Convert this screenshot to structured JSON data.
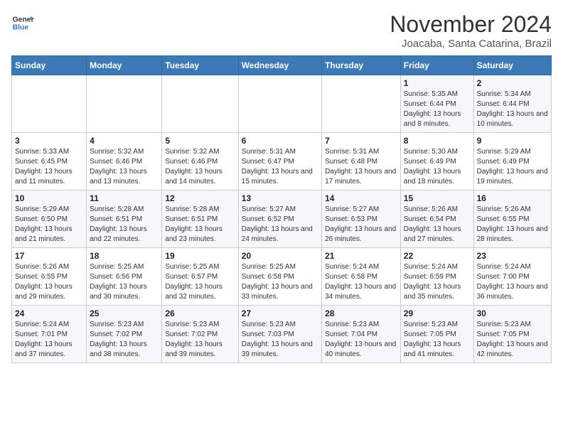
{
  "header": {
    "logo_text_top": "General",
    "logo_text_bottom": "Blue",
    "title": "November 2024",
    "subtitle": "Joacaba, Santa Catarina, Brazil"
  },
  "weekdays": [
    "Sunday",
    "Monday",
    "Tuesday",
    "Wednesday",
    "Thursday",
    "Friday",
    "Saturday"
  ],
  "weeks": [
    [
      {
        "day": "",
        "info": ""
      },
      {
        "day": "",
        "info": ""
      },
      {
        "day": "",
        "info": ""
      },
      {
        "day": "",
        "info": ""
      },
      {
        "day": "",
        "info": ""
      },
      {
        "day": "1",
        "info": "Sunrise: 5:35 AM\nSunset: 6:44 PM\nDaylight: 13 hours and 8 minutes."
      },
      {
        "day": "2",
        "info": "Sunrise: 5:34 AM\nSunset: 6:44 PM\nDaylight: 13 hours and 10 minutes."
      }
    ],
    [
      {
        "day": "3",
        "info": "Sunrise: 5:33 AM\nSunset: 6:45 PM\nDaylight: 13 hours and 11 minutes."
      },
      {
        "day": "4",
        "info": "Sunrise: 5:32 AM\nSunset: 6:46 PM\nDaylight: 13 hours and 13 minutes."
      },
      {
        "day": "5",
        "info": "Sunrise: 5:32 AM\nSunset: 6:46 PM\nDaylight: 13 hours and 14 minutes."
      },
      {
        "day": "6",
        "info": "Sunrise: 5:31 AM\nSunset: 6:47 PM\nDaylight: 13 hours and 15 minutes."
      },
      {
        "day": "7",
        "info": "Sunrise: 5:31 AM\nSunset: 6:48 PM\nDaylight: 13 hours and 17 minutes."
      },
      {
        "day": "8",
        "info": "Sunrise: 5:30 AM\nSunset: 6:49 PM\nDaylight: 13 hours and 18 minutes."
      },
      {
        "day": "9",
        "info": "Sunrise: 5:29 AM\nSunset: 6:49 PM\nDaylight: 13 hours and 19 minutes."
      }
    ],
    [
      {
        "day": "10",
        "info": "Sunrise: 5:29 AM\nSunset: 6:50 PM\nDaylight: 13 hours and 21 minutes."
      },
      {
        "day": "11",
        "info": "Sunrise: 5:28 AM\nSunset: 6:51 PM\nDaylight: 13 hours and 22 minutes."
      },
      {
        "day": "12",
        "info": "Sunrise: 5:28 AM\nSunset: 6:51 PM\nDaylight: 13 hours and 23 minutes."
      },
      {
        "day": "13",
        "info": "Sunrise: 5:27 AM\nSunset: 6:52 PM\nDaylight: 13 hours and 24 minutes."
      },
      {
        "day": "14",
        "info": "Sunrise: 5:27 AM\nSunset: 6:53 PM\nDaylight: 13 hours and 26 minutes."
      },
      {
        "day": "15",
        "info": "Sunrise: 5:26 AM\nSunset: 6:54 PM\nDaylight: 13 hours and 27 minutes."
      },
      {
        "day": "16",
        "info": "Sunrise: 5:26 AM\nSunset: 6:55 PM\nDaylight: 13 hours and 28 minutes."
      }
    ],
    [
      {
        "day": "17",
        "info": "Sunrise: 5:26 AM\nSunset: 6:55 PM\nDaylight: 13 hours and 29 minutes."
      },
      {
        "day": "18",
        "info": "Sunrise: 5:25 AM\nSunset: 6:56 PM\nDaylight: 13 hours and 30 minutes."
      },
      {
        "day": "19",
        "info": "Sunrise: 5:25 AM\nSunset: 6:57 PM\nDaylight: 13 hours and 32 minutes."
      },
      {
        "day": "20",
        "info": "Sunrise: 5:25 AM\nSunset: 6:58 PM\nDaylight: 13 hours and 33 minutes."
      },
      {
        "day": "21",
        "info": "Sunrise: 5:24 AM\nSunset: 6:58 PM\nDaylight: 13 hours and 34 minutes."
      },
      {
        "day": "22",
        "info": "Sunrise: 5:24 AM\nSunset: 6:59 PM\nDaylight: 13 hours and 35 minutes."
      },
      {
        "day": "23",
        "info": "Sunrise: 5:24 AM\nSunset: 7:00 PM\nDaylight: 13 hours and 36 minutes."
      }
    ],
    [
      {
        "day": "24",
        "info": "Sunrise: 5:24 AM\nSunset: 7:01 PM\nDaylight: 13 hours and 37 minutes."
      },
      {
        "day": "25",
        "info": "Sunrise: 5:23 AM\nSunset: 7:02 PM\nDaylight: 13 hours and 38 minutes."
      },
      {
        "day": "26",
        "info": "Sunrise: 5:23 AM\nSunset: 7:02 PM\nDaylight: 13 hours and 39 minutes."
      },
      {
        "day": "27",
        "info": "Sunrise: 5:23 AM\nSunset: 7:03 PM\nDaylight: 13 hours and 39 minutes."
      },
      {
        "day": "28",
        "info": "Sunrise: 5:23 AM\nSunset: 7:04 PM\nDaylight: 13 hours and 40 minutes."
      },
      {
        "day": "29",
        "info": "Sunrise: 5:23 AM\nSunset: 7:05 PM\nDaylight: 13 hours and 41 minutes."
      },
      {
        "day": "30",
        "info": "Sunrise: 5:23 AM\nSunset: 7:05 PM\nDaylight: 13 hours and 42 minutes."
      }
    ]
  ]
}
